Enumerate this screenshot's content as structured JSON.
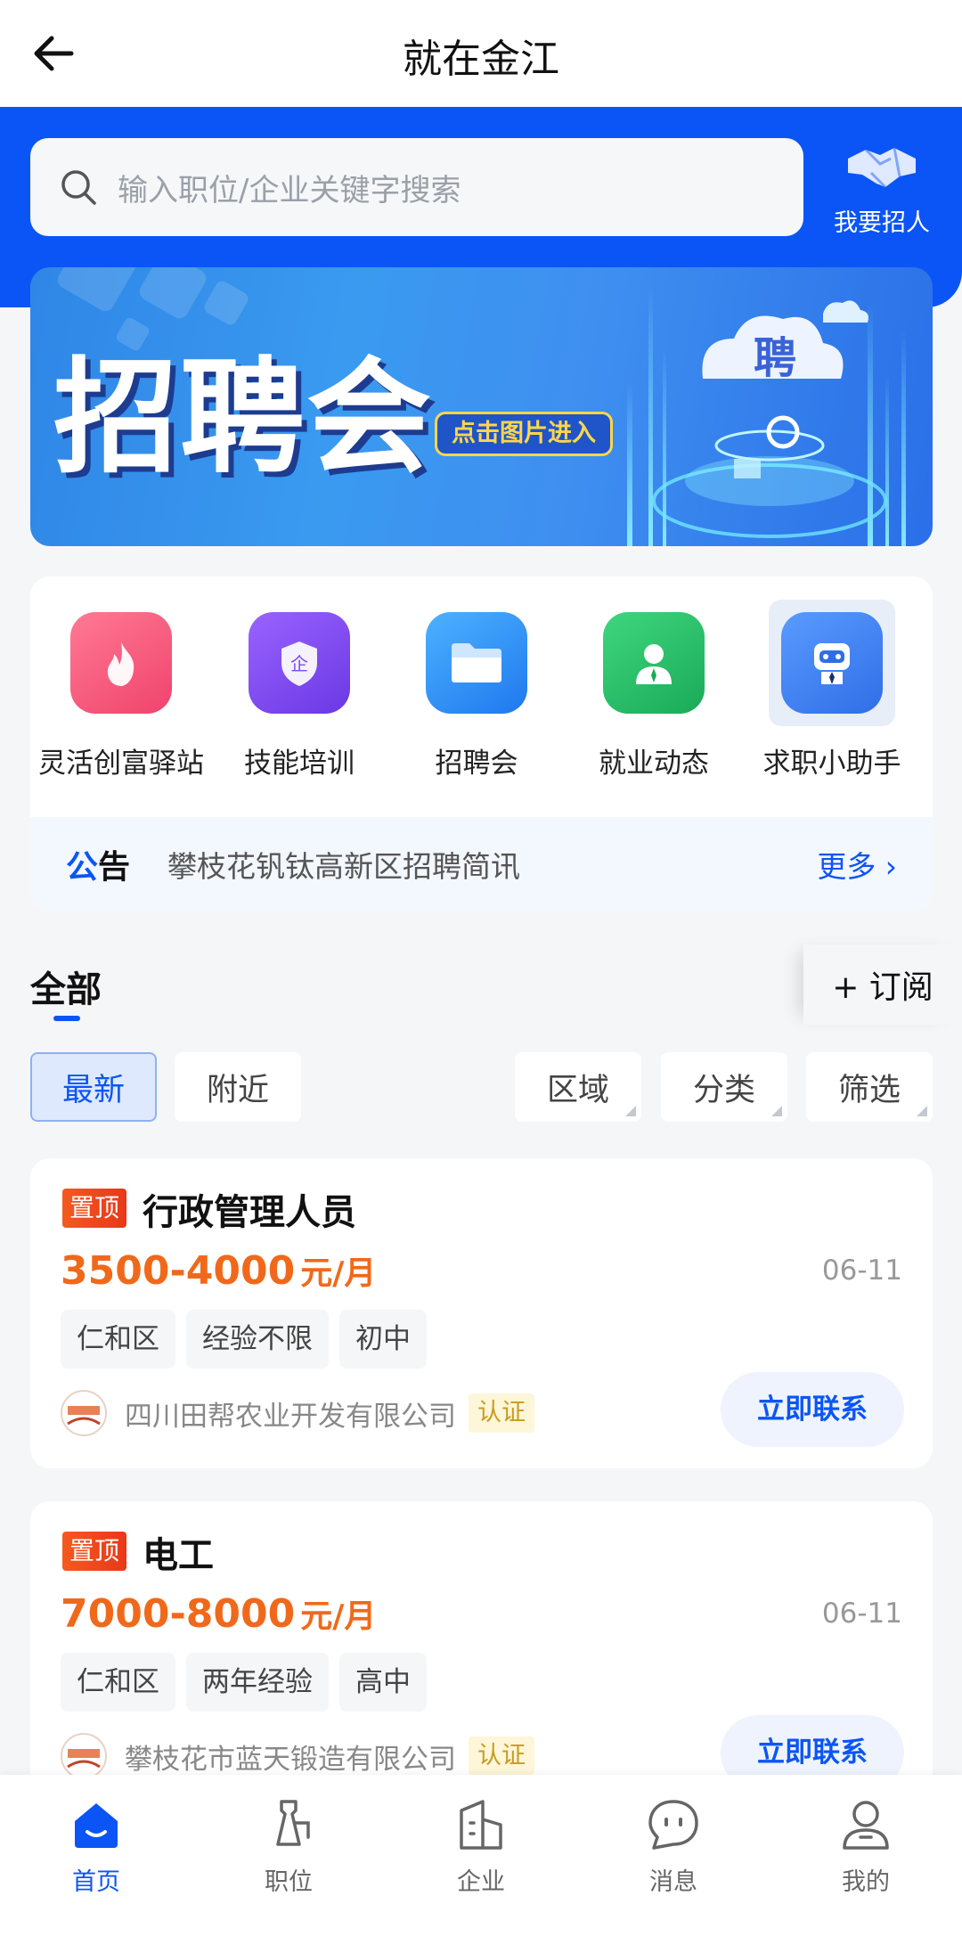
{
  "header": {
    "title": "就在金江",
    "back_icon": "arrow-left-icon"
  },
  "search": {
    "placeholder": "输入职位/企业关键字搜索",
    "icon": "search-icon"
  },
  "recruit": {
    "label": "我要招人",
    "icon": "handshake-icon"
  },
  "banner": {
    "title": "招聘会",
    "button": "点击图片进入",
    "badge": "聘"
  },
  "entries": [
    {
      "label": "灵活创富驿站",
      "icon": "flame-icon",
      "color": "#f2547a"
    },
    {
      "label": "技能培训",
      "icon": "shield-icon",
      "color": "#7a4cf0"
    },
    {
      "label": "招聘会",
      "icon": "folder-icon",
      "color": "#2f8df2"
    },
    {
      "label": "就业动态",
      "icon": "person-icon",
      "color": "#27c06a"
    },
    {
      "label": "求职小助手",
      "icon": "robot-icon",
      "color": "#3c7df0"
    }
  ],
  "notice": {
    "tag_a": "公",
    "tag_b": "告",
    "text": "攀枝花钒钛高新区招聘简讯",
    "more": "更多 ›"
  },
  "list": {
    "tab": "全部",
    "subscribe": "+ 订阅"
  },
  "filters": {
    "latest": "最新",
    "nearby": "附近",
    "region": "区域",
    "category": "分类",
    "filter": "筛选"
  },
  "jobs": [
    {
      "pin": "置顶",
      "title": "行政管理人员",
      "salary": "3500-4000",
      "unit": "元/月",
      "date": "06-11",
      "tags": [
        "仁和区",
        "经验不限",
        "初中"
      ],
      "company": "四川田帮农业开发有限公司",
      "cert": "认证",
      "contact": "立即联系"
    },
    {
      "pin": "置顶",
      "title": "电工",
      "salary": "7000-8000",
      "unit": "元/月",
      "date": "06-11",
      "tags": [
        "仁和区",
        "两年经验",
        "高中"
      ],
      "company": "攀枝花市蓝天锻造有限公司",
      "cert": "认证",
      "contact": "立即联系"
    }
  ],
  "tabbar": [
    {
      "label": "首页",
      "icon": "home-icon",
      "active": true
    },
    {
      "label": "职位",
      "icon": "briefcase-icon",
      "active": false
    },
    {
      "label": "企业",
      "icon": "building-icon",
      "active": false
    },
    {
      "label": "消息",
      "icon": "message-icon",
      "active": false
    },
    {
      "label": "我的",
      "icon": "user-icon",
      "active": false
    }
  ],
  "colors": {
    "primary": "#0b55f6",
    "salary": "#f0691b",
    "pin": "#f04b1b"
  }
}
